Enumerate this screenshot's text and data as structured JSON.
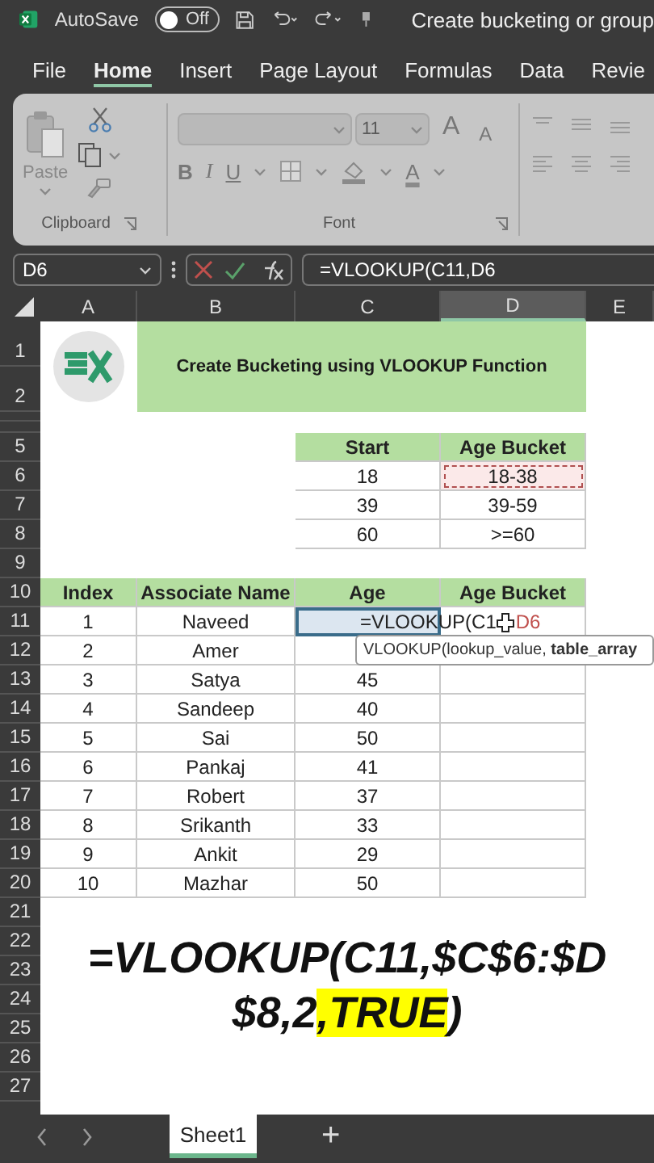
{
  "title_bar": {
    "autosave_label": "AutoSave",
    "autosave": {
      "label": "Off",
      "on": false
    },
    "document_title": "Create bucketing or group"
  },
  "tabs": [
    {
      "label": "File",
      "selected": false
    },
    {
      "label": "Home",
      "selected": true
    },
    {
      "label": "Insert",
      "selected": false
    },
    {
      "label": "Page Layout",
      "selected": false
    },
    {
      "label": "Formulas",
      "selected": false
    },
    {
      "label": "Data",
      "selected": false
    },
    {
      "label": "Revie",
      "selected": false
    }
  ],
  "ribbon": {
    "paste_label": "Paste",
    "font_size": "11",
    "bold": "B",
    "italic": "I",
    "underline": "U",
    "grow": "A",
    "shrink": "A",
    "font_color": "A",
    "groups": [
      {
        "label": "Clipboard"
      },
      {
        "label": "Font"
      }
    ]
  },
  "formula_bar": {
    "name_box": "D6",
    "formula": "=VLOOKUP(C11,D6"
  },
  "columns": [
    {
      "label": "A",
      "selected": false
    },
    {
      "label": "B",
      "selected": false
    },
    {
      "label": "C",
      "selected": false
    },
    {
      "label": "D",
      "selected": true
    },
    {
      "label": "E",
      "selected": false
    }
  ],
  "row_numbers": [
    "1",
    "2",
    "5",
    "6",
    "7",
    "8",
    "9",
    "10",
    "11",
    "12",
    "13",
    "14",
    "15",
    "16",
    "17",
    "18",
    "19",
    "20",
    "21",
    "22",
    "23",
    "24",
    "25",
    "26",
    "27"
  ],
  "title_cell": "Create Bucketing using VLOOKUP Function",
  "lookup_table": {
    "columns": [
      "Start",
      "Age Bucket"
    ],
    "rows": [
      {
        "start": "18",
        "bucket": "18-38",
        "copy_marked": true
      },
      {
        "start": "39",
        "bucket": "39-59",
        "copy_marked": false
      },
      {
        "start": "60",
        "bucket": ">=60",
        "copy_marked": false
      }
    ]
  },
  "data_table": {
    "columns": [
      "Index",
      "Associate Name",
      "Age",
      "Age Bucket"
    ],
    "rows": [
      {
        "index": "1",
        "name": "Naveed",
        "age": ""
      },
      {
        "index": "2",
        "name": "Amer",
        "age": ""
      },
      {
        "index": "3",
        "name": "Satya",
        "age": "45"
      },
      {
        "index": "4",
        "name": "Sandeep",
        "age": "40"
      },
      {
        "index": "5",
        "name": "Sai",
        "age": "50"
      },
      {
        "index": "6",
        "name": "Pankaj",
        "age": "41"
      },
      {
        "index": "7",
        "name": "Robert",
        "age": "37"
      },
      {
        "index": "8",
        "name": "Srikanth",
        "age": "33"
      },
      {
        "index": "9",
        "name": "Ankit",
        "age": "29"
      },
      {
        "index": "10",
        "name": "Mazhar",
        "age": "50"
      }
    ]
  },
  "cell_editor": {
    "text": "=VLOOKUP(C1",
    "reference": "D6"
  },
  "tooltip": "VLOOKUP(lookup_value, **table_array**",
  "big_formula": {
    "line_1": "=VLOOKUP(C11,$C$6:$D",
    "line_2_before": "$8,2",
    "line_2_highlighted": ",TRUE",
    "line_2_after": ")"
  },
  "sheet_tabs": [
    {
      "label": "Sheet1",
      "selected": true
    }
  ],
  "add_sheet": "+"
}
